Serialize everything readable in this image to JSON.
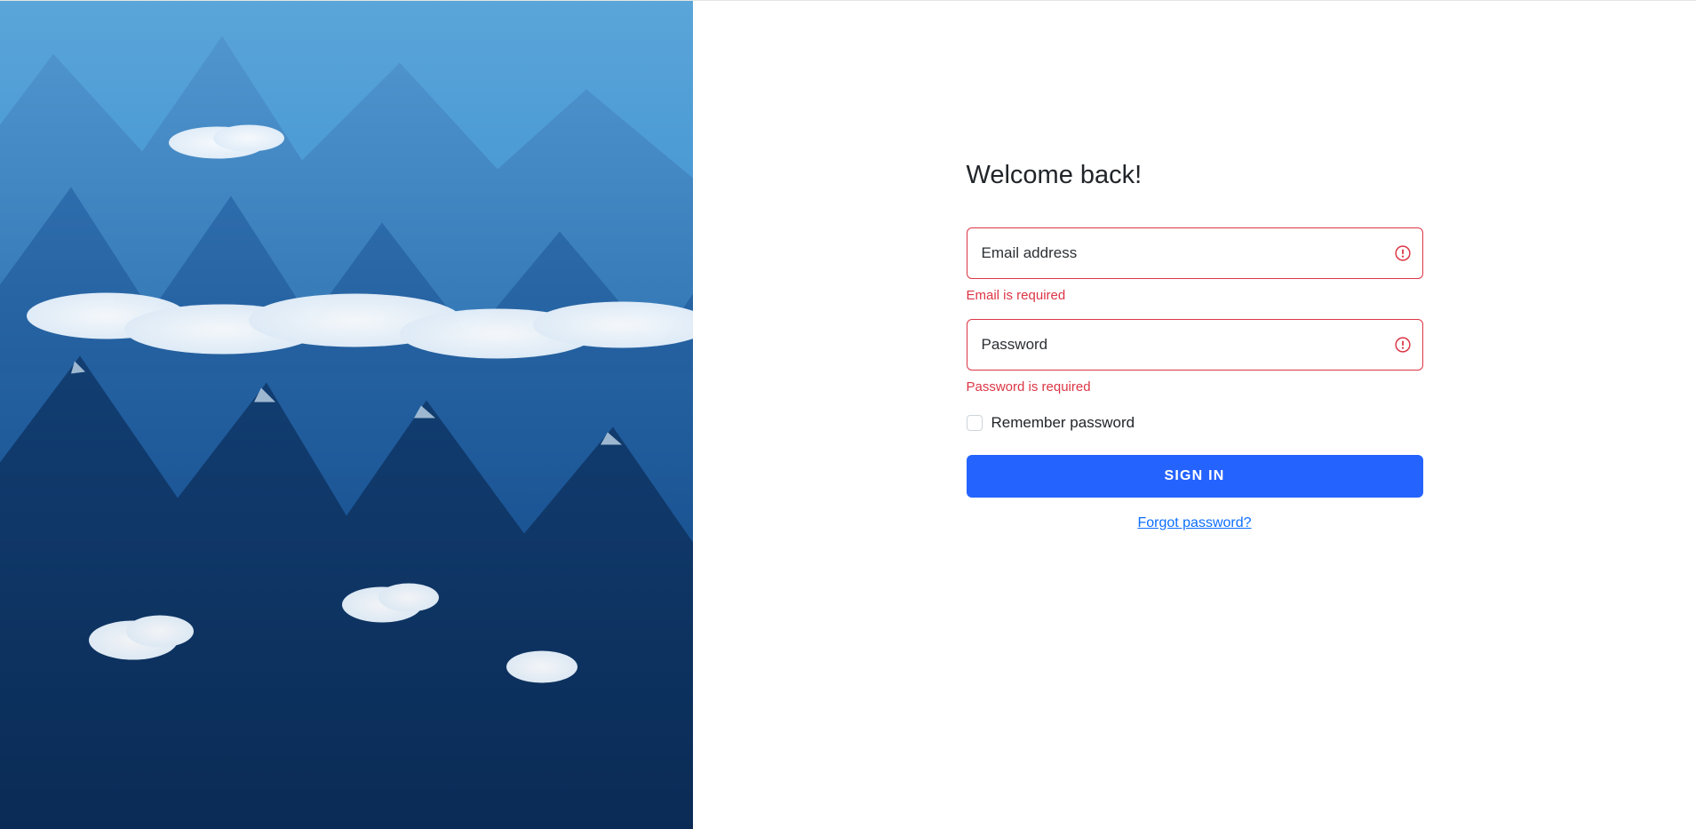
{
  "login": {
    "title": "Welcome back!",
    "email": {
      "placeholder": "Email address",
      "value": "",
      "error": "Email is required"
    },
    "password": {
      "placeholder": "Password",
      "value": "",
      "error": "Password is required"
    },
    "remember_label": "Remember password",
    "signin_label": "SIGN IN",
    "forgot_label": "Forgot password?"
  },
  "colors": {
    "error": "#dc3545",
    "primary": "#2563ff",
    "link": "#0d6efd"
  }
}
